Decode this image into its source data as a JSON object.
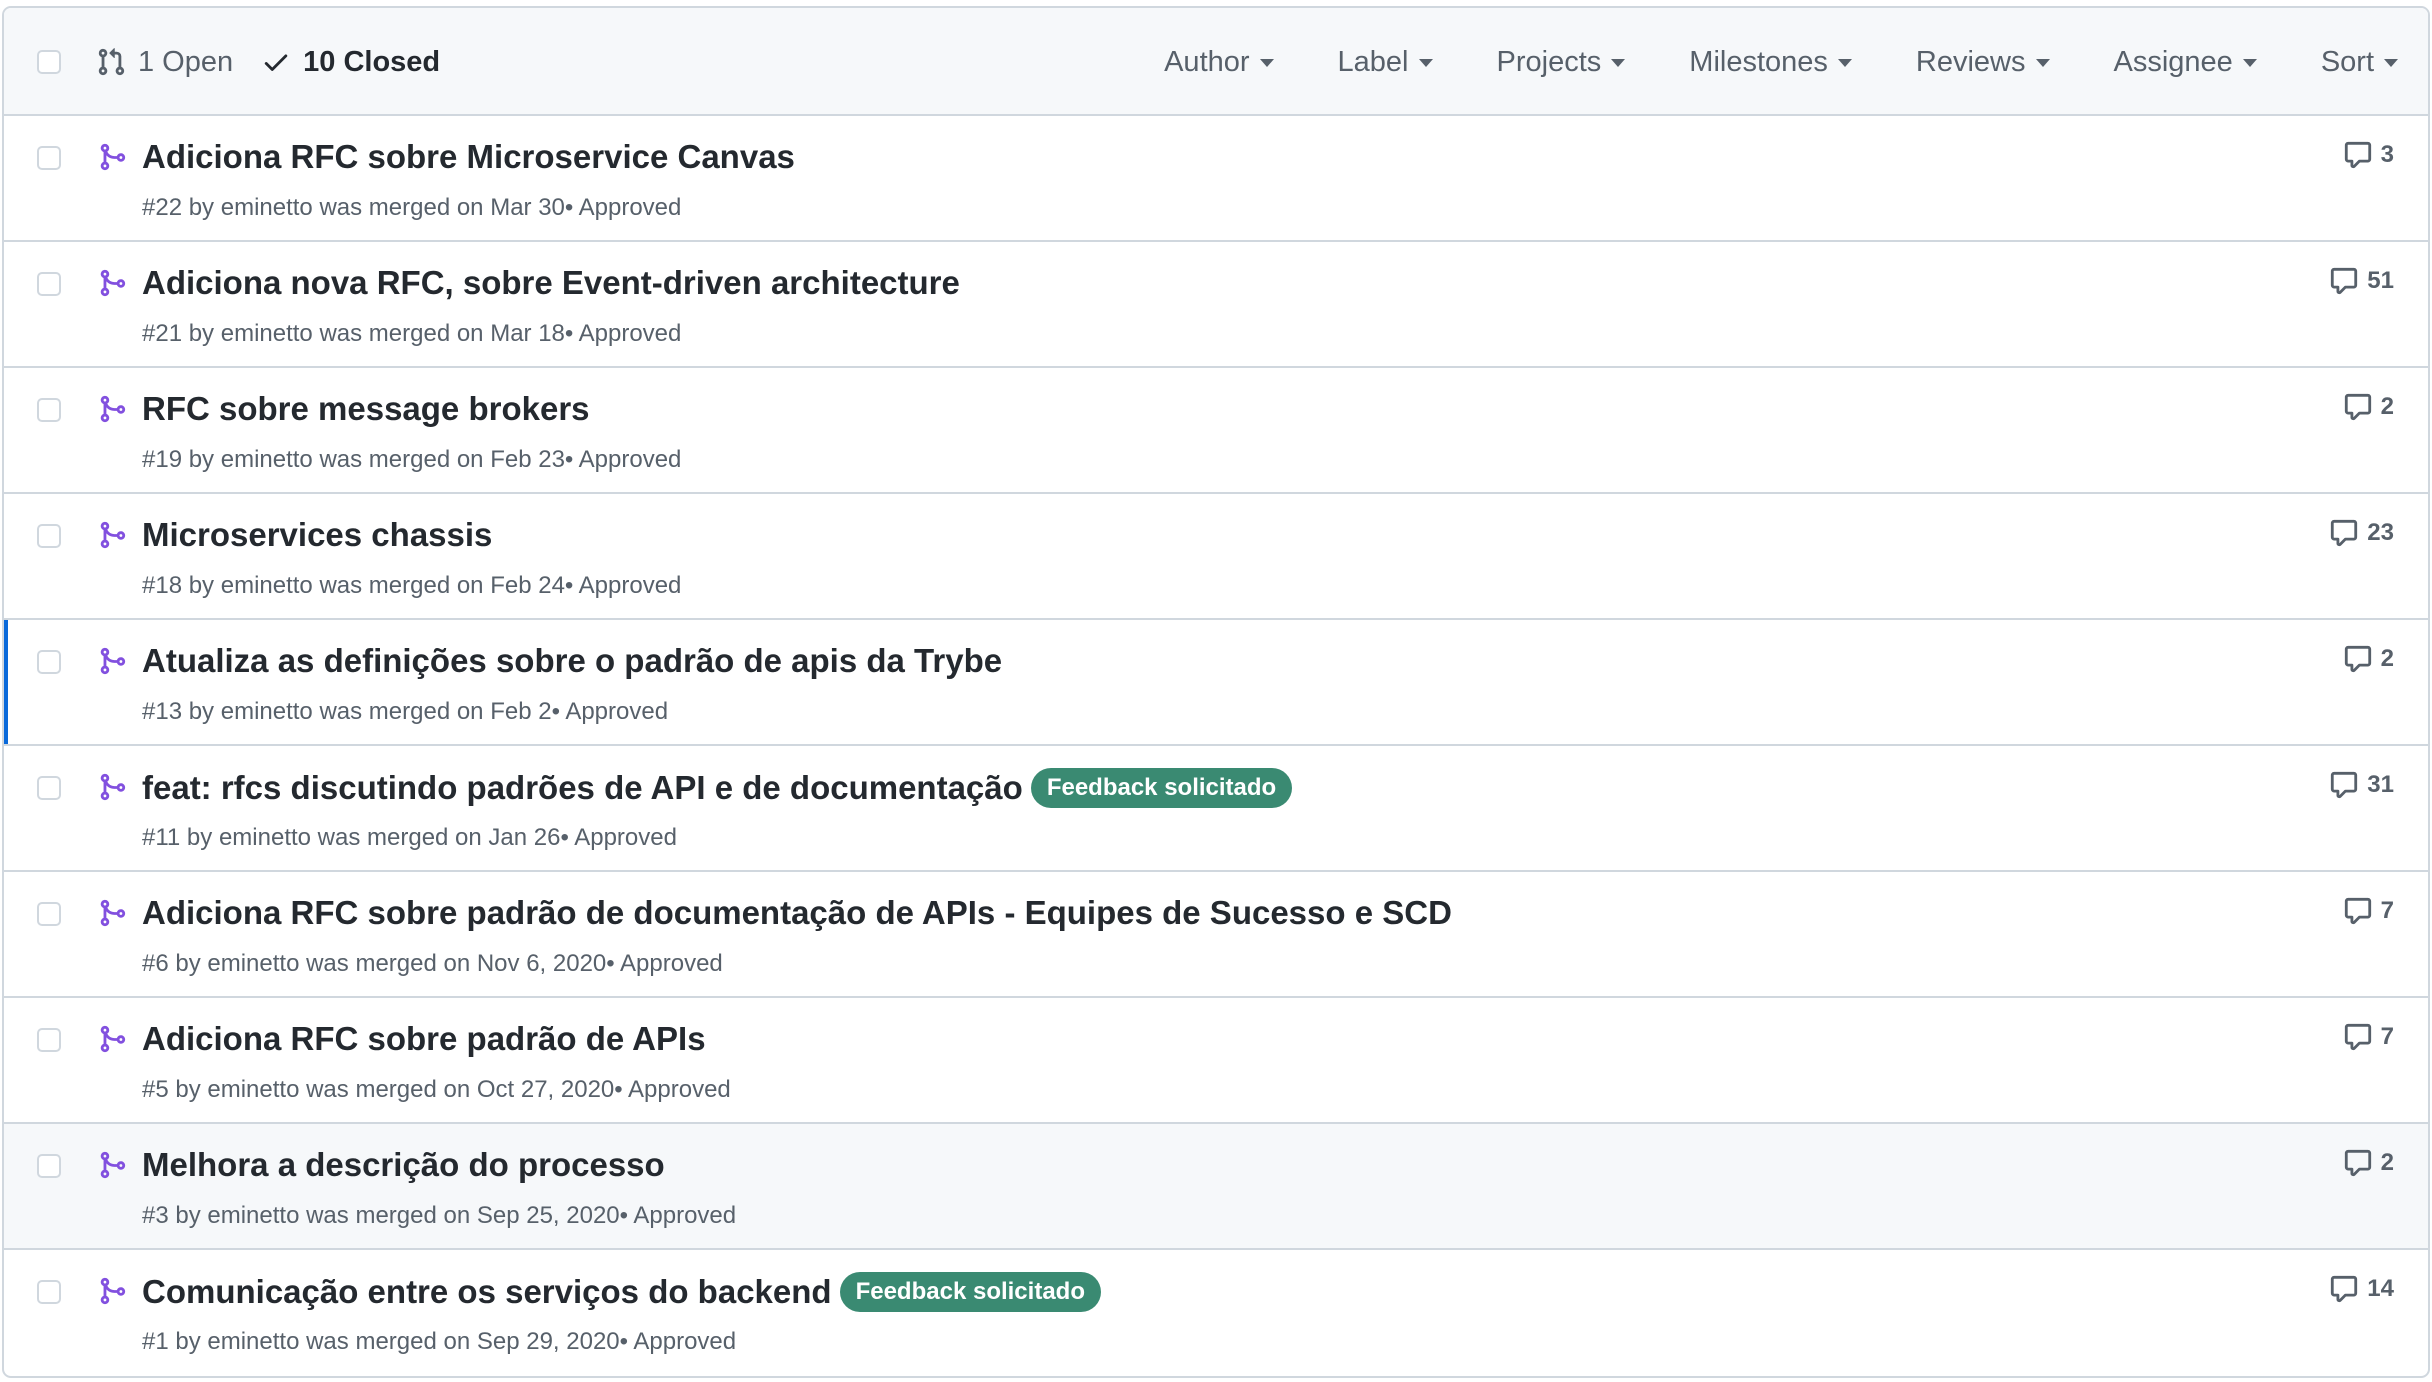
{
  "header": {
    "open_label": "1 Open",
    "closed_label": "10 Closed",
    "filters": [
      "Author",
      "Label",
      "Projects",
      "Milestones",
      "Reviews",
      "Assignee",
      "Sort"
    ]
  },
  "colors": {
    "merged_icon": "#8250df",
    "label_bg": "#3a8a72",
    "selected_bar": "#0969da"
  },
  "pulls": [
    {
      "title": "Adiciona RFC sobre Microservice Canvas",
      "meta": "#22 by eminetto was merged on Mar 30• Approved",
      "comments": "3",
      "label": ""
    },
    {
      "title": "Adiciona nova RFC, sobre Event-driven architecture",
      "meta": "#21 by eminetto was merged on Mar 18• Approved",
      "comments": "51",
      "label": ""
    },
    {
      "title": "RFC sobre message brokers",
      "meta": "#19 by eminetto was merged on Feb 23• Approved",
      "comments": "2",
      "label": ""
    },
    {
      "title": "Microservices chassis",
      "meta": "#18 by eminetto was merged on Feb 24• Approved",
      "comments": "23",
      "label": ""
    },
    {
      "title": "Atualiza as definições sobre o padrão de apis da Trybe",
      "meta": "#13 by eminetto was merged on Feb 2• Approved",
      "comments": "2",
      "label": ""
    },
    {
      "title": "feat: rfcs discutindo padrões de API e de documentação",
      "meta": "#11 by eminetto was merged on Jan 26• Approved",
      "comments": "31",
      "label": "Feedback solicitado"
    },
    {
      "title": "Adiciona RFC sobre padrão de documentação de APIs - Equipes de Sucesso e SCD",
      "meta": "#6 by eminetto was merged on Nov 6, 2020• Approved",
      "comments": "7",
      "label": ""
    },
    {
      "title": "Adiciona RFC sobre padrão de APIs",
      "meta": "#5 by eminetto was merged on Oct 27, 2020• Approved",
      "comments": "7",
      "label": ""
    },
    {
      "title": "Melhora a descrição do processo",
      "meta": "#3 by eminetto was merged on Sep 25, 2020• Approved",
      "comments": "2",
      "label": ""
    },
    {
      "title": "Comunicação entre os serviços do backend",
      "meta": "#1 by eminetto was merged on Sep 29, 2020• Approved",
      "comments": "14",
      "label": "Feedback solicitado"
    }
  ]
}
